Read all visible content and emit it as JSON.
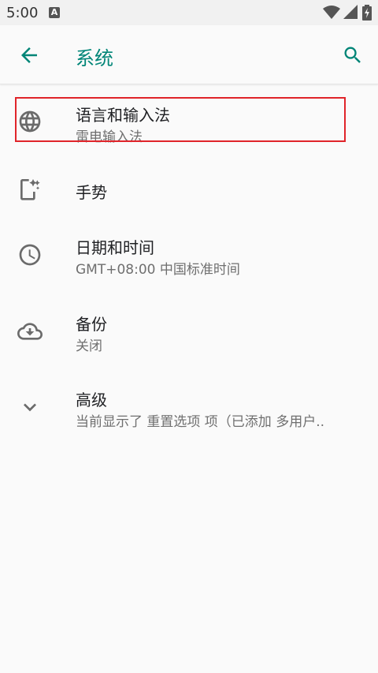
{
  "status_bar": {
    "time": "5:00",
    "notification_icon": "a-icon",
    "wifi_icon": "wifi-icon",
    "signal_icon": "signal-icon",
    "battery_icon": "battery-charging-icon"
  },
  "toolbar": {
    "title": "系统",
    "back_icon": "arrow-back-icon",
    "search_icon": "search-icon",
    "accent_color": "#008577"
  },
  "items": [
    {
      "title": "语言和输入法",
      "subtitle": "雷电输入法",
      "icon": "globe-icon"
    },
    {
      "title": "手势",
      "subtitle": "",
      "icon": "gesture-phone-icon"
    },
    {
      "title": "日期和时间",
      "subtitle": "GMT+08:00 中国标准时间",
      "icon": "clock-icon"
    },
    {
      "title": "备份",
      "subtitle": "关闭",
      "icon": "cloud-backup-icon"
    },
    {
      "title": "高级",
      "subtitle": "当前显示了 重置选项 项（已添加 多用户..",
      "icon": "chevron-down-icon"
    }
  ],
  "highlight_color": "#e0242a"
}
